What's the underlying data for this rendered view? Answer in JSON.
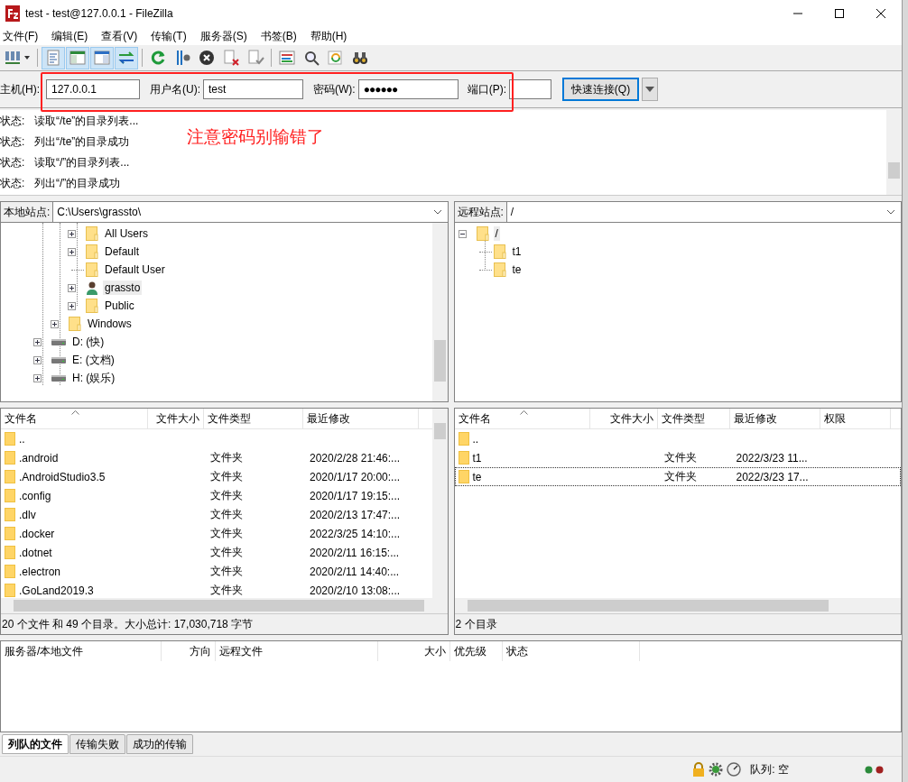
{
  "window": {
    "title": "test - test@127.0.0.1 - FileZilla"
  },
  "menu": [
    "文件(F)",
    "编辑(E)",
    "查看(V)",
    "传输(T)",
    "服务器(S)",
    "书签(B)",
    "帮助(H)"
  ],
  "toolbar": {
    "toggles": [
      {
        "on": true
      },
      {
        "on": true
      },
      {
        "on": true
      },
      {
        "on": true
      }
    ]
  },
  "quickconnect": {
    "host_label": "主机(H):",
    "host": "127.0.0.1",
    "user_label": "用户名(U):",
    "user": "test",
    "password_label": "密码(W):",
    "password": "●●●●●●",
    "port_label": "端口(P):",
    "button": "快速连接(Q)"
  },
  "annotation": "注意密码别输错了",
  "log": [
    {
      "label": "状态:",
      "message": "读取“/te”的目录列表..."
    },
    {
      "label": "状态:",
      "message": "列出“/te”的目录成功"
    },
    {
      "label": "状态:",
      "message": "读取“/”的目录列表..."
    },
    {
      "label": "状态:",
      "message": "列出“/”的目录成功"
    }
  ],
  "local_site": {
    "label": "本地站点:",
    "path": "C:\\Users\\grassto\\"
  },
  "local_tree": [
    {
      "children": [
        {
          "children": [
            {
              "label": "All Users",
              "kind": "folder",
              "expandable": true,
              "expanded": false,
              "selected": false
            },
            {
              "label": "Default",
              "kind": "folder",
              "expandable": true,
              "expanded": false,
              "selected": false
            },
            {
              "label": "Default User",
              "kind": "folder",
              "expandable": false,
              "selected": false
            },
            {
              "label": "grassto",
              "kind": "user",
              "expandable": true,
              "expanded": false,
              "selected": true
            },
            {
              "label": "Public",
              "kind": "folder",
              "expandable": true,
              "expanded": false,
              "selected": false
            }
          ]
        },
        {
          "label": "Windows",
          "kind": "folder",
          "expandable": true,
          "expanded": false,
          "selected": false
        }
      ]
    },
    {
      "label": "D: (快)",
      "kind": "drive",
      "expandable": true,
      "expanded": false,
      "selected": false
    },
    {
      "label": "E: (文档)",
      "kind": "drive",
      "expandable": true,
      "expanded": false,
      "selected": false
    },
    {
      "label": "H: (娱乐)",
      "kind": "drive",
      "expandable": true,
      "expanded": false,
      "selected": false
    }
  ],
  "remote_site": {
    "label": "远程站点:",
    "path": "/"
  },
  "remote_tree": [
    {
      "label": "/",
      "kind": "folder",
      "expandable": true,
      "expanded": true,
      "selected": true,
      "children": [
        {
          "label": "t1",
          "kind": "folder",
          "expandable": false,
          "selected": false
        },
        {
          "label": "te",
          "kind": "folder",
          "expandable": false,
          "selected": false
        }
      ]
    }
  ],
  "local_list": {
    "columns": [
      "文件名",
      "文件大小",
      "文件类型",
      "最近修改"
    ],
    "rows": [
      {
        "name": ".."
      },
      {
        "name": ".android",
        "type": "文件夹",
        "modified": "2020/2/28 21:46:..."
      },
      {
        "name": ".AndroidStudio3.5",
        "type": "文件夹",
        "modified": "2020/1/17 20:00:..."
      },
      {
        "name": ".config",
        "type": "文件夹",
        "modified": "2020/1/17 19:15:..."
      },
      {
        "name": ".dlv",
        "type": "文件夹",
        "modified": "2020/2/13 17:47:..."
      },
      {
        "name": ".docker",
        "type": "文件夹",
        "modified": "2022/3/25 14:10:..."
      },
      {
        "name": ".dotnet",
        "type": "文件夹",
        "modified": "2020/2/11 16:15:..."
      },
      {
        "name": ".electron",
        "type": "文件夹",
        "modified": "2020/2/11 14:40:..."
      },
      {
        "name": ".GoLand2019.3",
        "type": "文件夹",
        "modified": "2020/2/10 13:08:..."
      }
    ],
    "status": "20 个文件 和 49 个目录。大小总计: 17,030,718 字节"
  },
  "remote_list": {
    "columns": [
      "文件名",
      "文件大小",
      "文件类型",
      "最近修改",
      "权限"
    ],
    "rows": [
      {
        "name": "..",
        "focused": false
      },
      {
        "name": "t1",
        "type": "文件夹",
        "modified": "2022/3/23 11...",
        "focused": false
      },
      {
        "name": "te",
        "type": "文件夹",
        "modified": "2022/3/23 17...",
        "focused": true
      }
    ],
    "status": "2 个目录"
  },
  "queue": {
    "columns": [
      "服务器/本地文件",
      "方向",
      "远程文件",
      "大小",
      "优先级",
      "状态"
    ]
  },
  "tabs": [
    {
      "label": "列队的文件",
      "selected": true
    },
    {
      "label": "传输失败",
      "selected": false
    },
    {
      "label": "成功的传输",
      "selected": false
    }
  ],
  "status_bar": {
    "queue": "队列: 空"
  }
}
